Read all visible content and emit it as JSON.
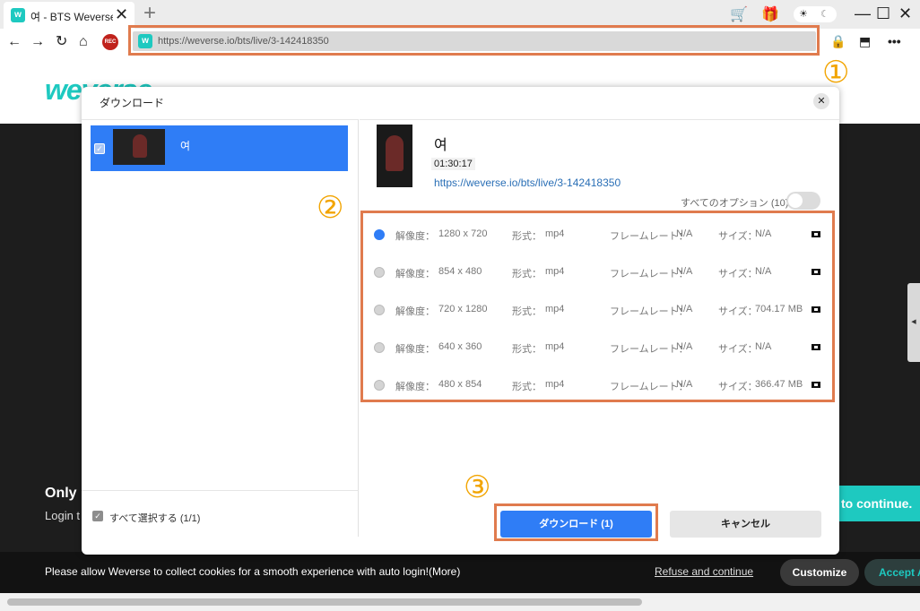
{
  "browser": {
    "tab_title": "여 - BTS Weverse",
    "favicon_letter": "w",
    "url": "https://weverse.io/bts/live/3-142418350",
    "rec_label": "REC"
  },
  "page": {
    "logo_text": "weverse",
    "only_text": "Only",
    "login_text": "Login t",
    "continue_text": "to continue.",
    "cookie_text": "Please allow Weverse to collect cookies for a smooth experience with auto login!(More)",
    "refuse_text": "Refuse and continue",
    "customize_text": "Customize",
    "accept_text": "Accept A"
  },
  "dialog": {
    "title": "ダウンロード",
    "video_name": "여",
    "select_all": "すべて選択する (1/1)",
    "duration": "01:30:17",
    "video_url": "https://weverse.io/bts/live/3-142418350",
    "all_options": "すべてのオプション (10)",
    "download_button": "ダウンロード (1)",
    "cancel_button": "キャンセル"
  },
  "formats": [
    {
      "res_label": "解像度：",
      "resolution": "1280 x 720",
      "fmt_label": "形式：",
      "format": "mp4",
      "fps_label": "フレームレート：",
      "fps": "N/A",
      "size_label": "サイズ：",
      "size": "N/A",
      "selected": true
    },
    {
      "res_label": "解像度：",
      "resolution": "854 x 480",
      "fmt_label": "形式：",
      "format": "mp4",
      "fps_label": "フレームレート：",
      "fps": "N/A",
      "size_label": "サイズ：",
      "size": "N/A",
      "selected": false
    },
    {
      "res_label": "解像度：",
      "resolution": "720 x 1280",
      "fmt_label": "形式：",
      "format": "mp4",
      "fps_label": "フレームレート：",
      "fps": "N/A",
      "size_label": "サイズ：",
      "size": "704.17 MB",
      "selected": false
    },
    {
      "res_label": "解像度：",
      "resolution": "640 x 360",
      "fmt_label": "形式：",
      "format": "mp4",
      "fps_label": "フレームレート：",
      "fps": "N/A",
      "size_label": "サイズ：",
      "size": "N/A",
      "selected": false
    },
    {
      "res_label": "解像度：",
      "resolution": "480 x 854",
      "fmt_label": "形式：",
      "format": "mp4",
      "fps_label": "フレームレート：",
      "fps": "N/A",
      "size_label": "サイズ：",
      "size": "366.47 MB",
      "selected": false
    }
  ],
  "callouts": [
    "①",
    "②",
    "③"
  ],
  "colors": {
    "accent": "#2f7df6",
    "brand": "#1ec9c0",
    "callout": "#e07b4e",
    "callout_number": "#f2a400"
  }
}
